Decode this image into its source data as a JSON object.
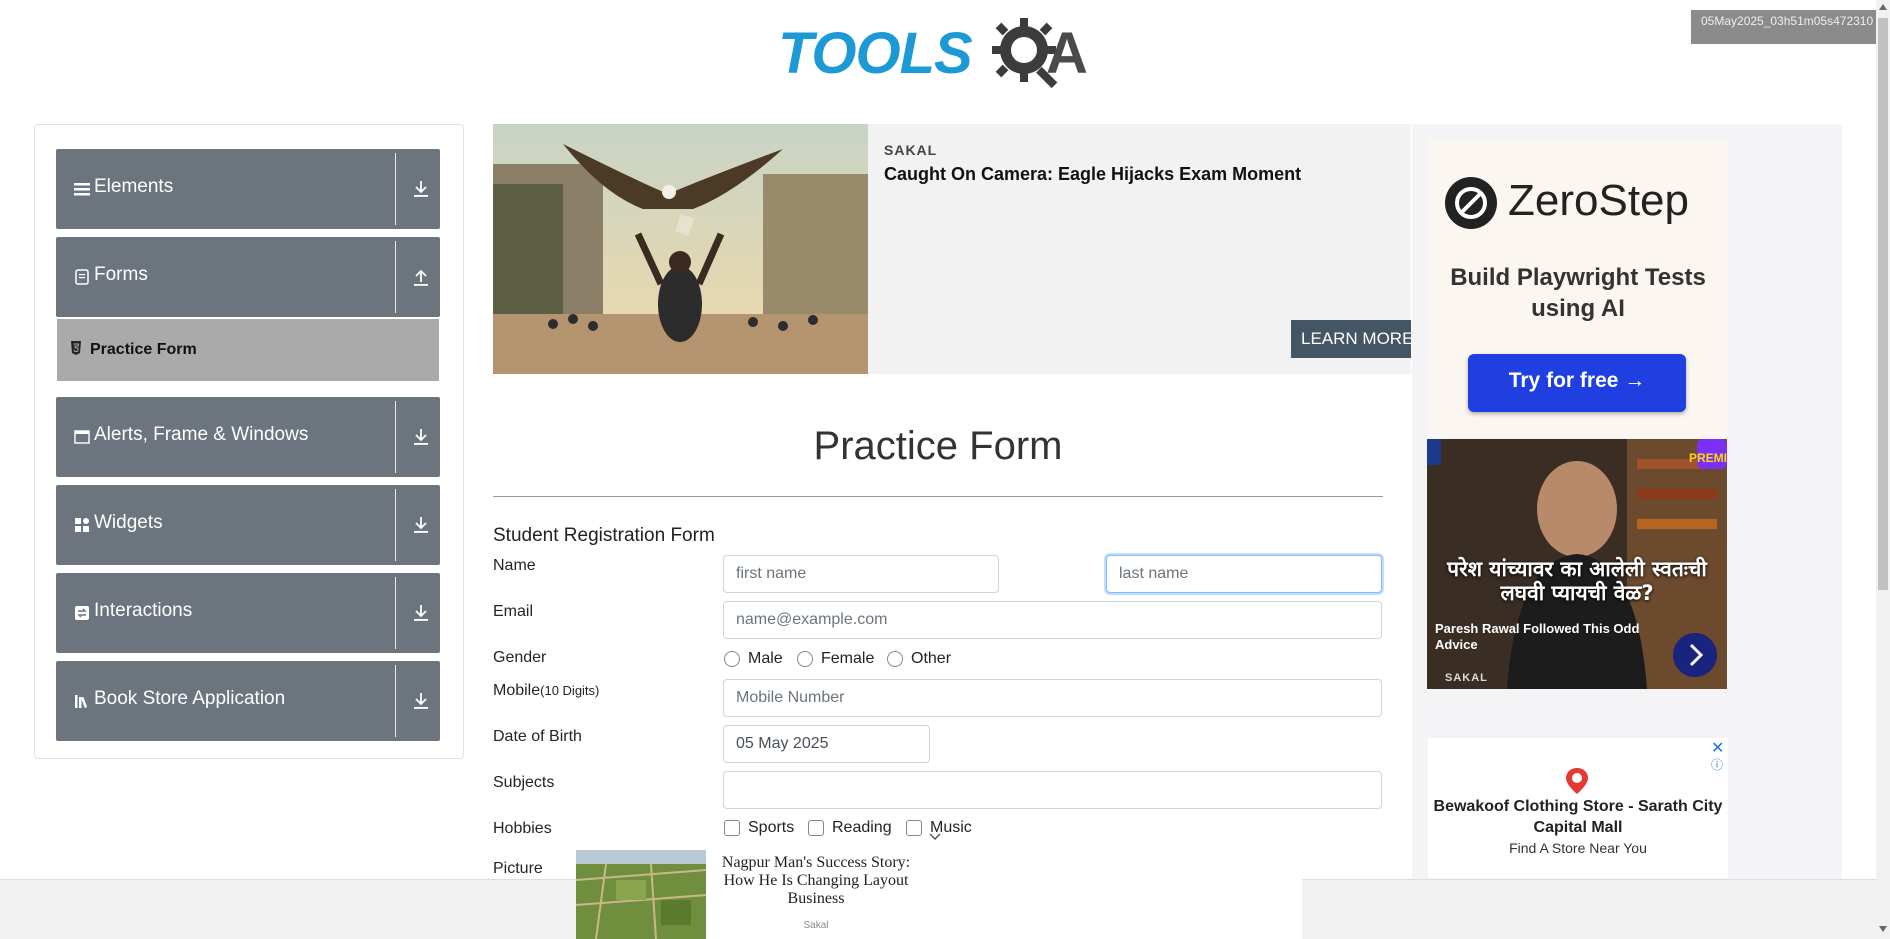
{
  "header": {
    "logo_text": "TOOLS",
    "logo_suffix": "A",
    "timestamp": "05May2025_03h51m05s472310"
  },
  "sidebar": {
    "groups": [
      {
        "label": "Elements",
        "icon": "menu-lines-icon",
        "arrow": "download-icon"
      },
      {
        "label": "Forms",
        "icon": "document-icon",
        "arrow": "upload-icon"
      },
      {
        "label": "Alerts, Frame & Windows",
        "icon": "window-icon",
        "arrow": "download-icon"
      },
      {
        "label": "Widgets",
        "icon": "widgets-icon",
        "arrow": "download-icon"
      },
      {
        "label": "Interactions",
        "icon": "interactions-icon",
        "arrow": "download-icon"
      },
      {
        "label": "Book Store Application",
        "icon": "books-icon",
        "arrow": "download-icon"
      }
    ],
    "active_item": {
      "label": "Practice Form",
      "icon": "html5-icon"
    }
  },
  "banner_ad": {
    "source": "SAKAL",
    "headline": "Caught On Camera: Eagle Hijacks Exam Moment",
    "cta": "LEARN MORE"
  },
  "zerostep_ad": {
    "brand": "ZeroStep",
    "tagline": "Build Playwright Tests using AI",
    "cta": "Try for free →"
  },
  "paresh_ad": {
    "overlay": "परेश यांच्यावर का आलेली स्वतःची लघवी प्यायची वेळ?",
    "caption": "Paresh Rawal Followed This Odd Advice",
    "source": "SAKAL",
    "badge": "PREMI"
  },
  "bewakoof_ad": {
    "title": "Bewakoof Clothing Store - Sarath City Capital Mall",
    "subtitle": "Find A Store Near You"
  },
  "form": {
    "title": "Practice Form",
    "subtitle": "Student Registration Form",
    "labels": {
      "name": "Name",
      "email": "Email",
      "gender": "Gender",
      "mobile": "Mobile",
      "mobile_hint": "(10 Digits)",
      "dob": "Date of Birth",
      "subjects": "Subjects",
      "hobbies": "Hobbies",
      "picture": "Picture"
    },
    "placeholders": {
      "first_name": "first name",
      "last_name": "last name",
      "email": "name@example.com",
      "mobile": "Mobile Number"
    },
    "values": {
      "dob": "05 May 2025",
      "subjects": ""
    },
    "gender_options": [
      "Male",
      "Female",
      "Other"
    ],
    "hobbies_options": [
      "Sports",
      "Reading",
      "Music"
    ]
  },
  "bottom_ad": {
    "headline": "Nagpur Man's Success Story: How He Is Changing Layout Business",
    "source": "Sakal"
  },
  "colors": {
    "sidebar_group": "#6c757d",
    "sidebar_active": "#aaaaaa",
    "logo_blue": "#1d9ad6",
    "zerostep_button": "#1f3fe0"
  }
}
